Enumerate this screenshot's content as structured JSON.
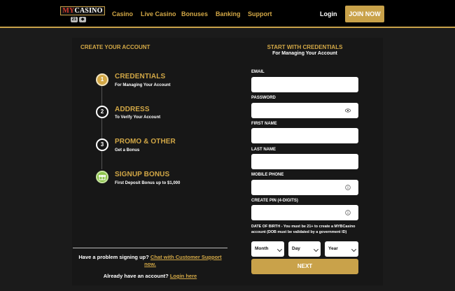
{
  "header": {
    "logo": {
      "my": "MY",
      "casino": "CASINO"
    },
    "nav": [
      "Casino",
      "Live Casino",
      "Bonuses",
      "Banking",
      "Support"
    ],
    "login_label": "Login",
    "join_label": "JOIN NOW"
  },
  "left": {
    "title": "CREATE YOUR ACCOUNT",
    "steps": [
      {
        "number": "1",
        "title": "CREDENTIALS",
        "subtitle": "For Managing Your Account"
      },
      {
        "number": "2",
        "title": "ADDRESS",
        "subtitle": "To Verify Your Account"
      },
      {
        "number": "3",
        "title": "PROMO & OTHER",
        "subtitle": "Get a Bonus"
      },
      {
        "title": "SIGNUP BONUS",
        "subtitle": "First Deposit Bonus up to $1,000"
      }
    ],
    "help_text": "Have a problem signing up?",
    "help_link": "Chat with Customer Support now.",
    "already_text": "Already have an account?",
    "login_link": "Login here"
  },
  "form": {
    "title": "START WITH CREDENTIALS",
    "subtitle": "For Managing Your Account",
    "fields": [
      {
        "label": "EMAIL",
        "value": ""
      },
      {
        "label": "PASSWORD",
        "value": ""
      },
      {
        "label": "FIRST NAME",
        "value": ""
      },
      {
        "label": "LAST NAME",
        "value": ""
      },
      {
        "label": "MOBILE PHONE",
        "value": ""
      },
      {
        "label": "CREATE PIN (4-DIGITS)",
        "value": ""
      }
    ],
    "dob_label": "DATE OF BIRTH",
    "dob_note": " - You must be 21+ to create a MYBCasino account (DOB must be validated by a government ID)",
    "dob_selects": [
      "Month",
      "Day",
      "Year"
    ],
    "next_label": "NEXT"
  },
  "colors": {
    "accent": "#c9a24a",
    "gift": "#8bc34a"
  }
}
